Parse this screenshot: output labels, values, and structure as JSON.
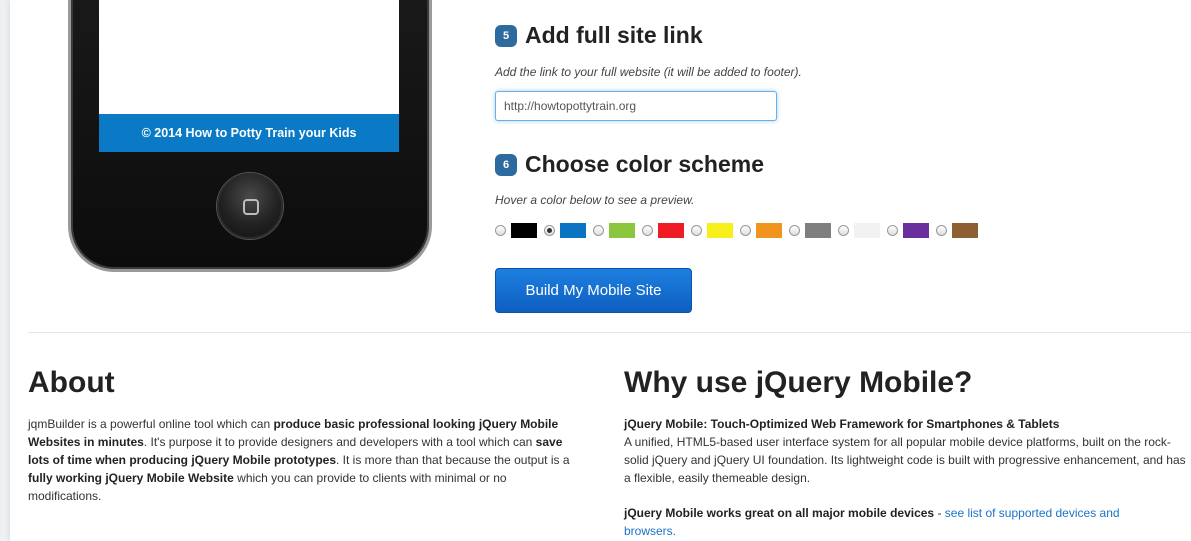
{
  "phone": {
    "footer_text": "© 2014 How to Potty Train your Kids"
  },
  "step5": {
    "number": "5",
    "title": "Add full site link",
    "hint": "Add the link to your full website (it will be added to footer).",
    "input_value": "http://howtopottytrain.org"
  },
  "step6": {
    "number": "6",
    "title": "Choose color scheme",
    "hint": "Hover a color below to see a preview.",
    "colors": [
      "#000000",
      "#0a73c2",
      "#8cc63e",
      "#ee1c24",
      "#f7f01a",
      "#f1941d",
      "#7f7f7f",
      "#f2f2f2",
      "#6a2e9e",
      "#8f5f34"
    ],
    "selected_index": 1
  },
  "build_button": "Build My Mobile Site",
  "about": {
    "title": "About",
    "p1_a": "jqmBuilder is a powerful online tool which can ",
    "p1_b": "produce basic professional looking jQuery Mobile Websites in minutes",
    "p1_c": ". It's purpose it to provide designers and developers with a tool which can ",
    "p1_d": "save lots of time when producing jQuery Mobile prototypes",
    "p1_e": ". It is more than that because the output is a ",
    "p1_f": "fully working jQuery Mobile Website",
    "p1_g": " which you can provide to clients with minimal or no modifications."
  },
  "why": {
    "title": "Why use jQuery Mobile?",
    "subtitle": "jQuery Mobile: Touch-Optimized Web Framework for Smartphones & Tablets",
    "body": "A unified, HTML5-based user interface system for all popular mobile device platforms, built on the rock-solid jQuery and jQuery UI foundation. Its lightweight code is built with progressive enhancement, and has a flexible, easily themeable design.",
    "p2_bold": "jQuery Mobile works great on all major mobile devices",
    "p2_sep": " - ",
    "p2_link": "see list of supported devices and browsers."
  }
}
